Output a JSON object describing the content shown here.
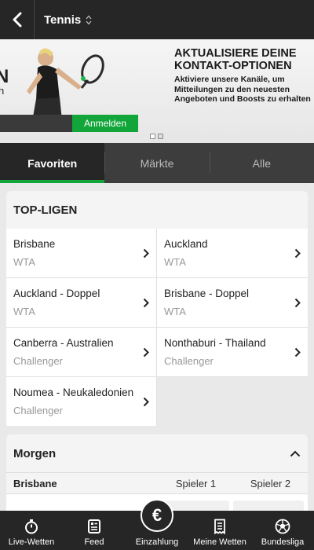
{
  "header": {
    "title": "Tennis"
  },
  "banner": {
    "left_title": "N",
    "left_sub": "h",
    "headline": "AKTUALISIERE DEINE KONTAKT-OPTIONEN",
    "text": "Aktiviere unsere Kanäle, um Mitteilungen zu den neuesten Angeboten und Boosts zu erhalten",
    "login_label": "Anmelden"
  },
  "tabs": [
    {
      "label": "Favoriten",
      "active": true
    },
    {
      "label": "Märkte",
      "active": false
    },
    {
      "label": "Alle",
      "active": false
    }
  ],
  "top_leagues": {
    "title": "TOP-LIGEN",
    "items": [
      {
        "name": "Brisbane",
        "sub": "WTA"
      },
      {
        "name": "Auckland",
        "sub": "WTA"
      },
      {
        "name": "Auckland - Doppel",
        "sub": "WTA"
      },
      {
        "name": "Brisbane - Doppel",
        "sub": "WTA"
      },
      {
        "name": "Canberra - Australien",
        "sub": "Challenger"
      },
      {
        "name": "Nonthaburi - Thailand",
        "sub": "Challenger"
      },
      {
        "name": "Noumea - Neukaledonien",
        "sub": "Challenger"
      }
    ]
  },
  "morgen": {
    "title": "Morgen",
    "league": "Brisbane",
    "col1": "Spieler 1",
    "col2": "Spieler 2"
  },
  "bottom_nav": [
    {
      "label": "Live-Wetten",
      "icon": "stopwatch-icon"
    },
    {
      "label": "Feed",
      "icon": "feed-icon"
    },
    {
      "label": "Einzahlung",
      "icon": "euro-icon",
      "glyph": "€"
    },
    {
      "label": "Meine Wetten",
      "icon": "betslip-icon"
    },
    {
      "label": "Bundesliga",
      "icon": "football-icon"
    }
  ],
  "colors": {
    "accent": "#12a63a",
    "header": "#262626",
    "tabs": "#3d3d3d"
  }
}
